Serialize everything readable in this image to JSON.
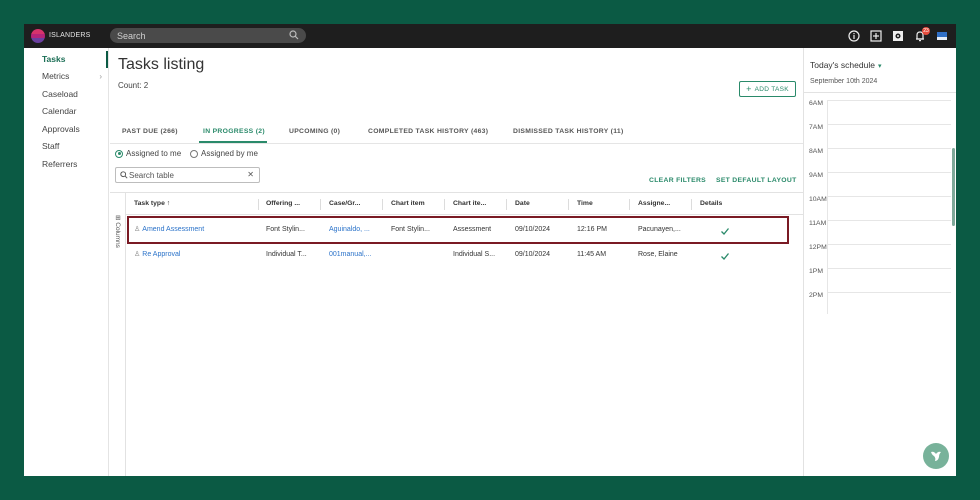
{
  "topbar": {
    "brand": "ISLANDERS",
    "search_placeholder": "Search",
    "notification_count": "23",
    "icons": [
      "info-icon",
      "plus-square-icon",
      "settings-icon",
      "bell-icon",
      "profile-icon"
    ]
  },
  "sidebar": {
    "items": [
      {
        "label": "Tasks",
        "active": true
      },
      {
        "label": "Metrics",
        "has_children": true
      },
      {
        "label": "Caseload"
      },
      {
        "label": "Calendar"
      },
      {
        "label": "Approvals"
      },
      {
        "label": "Staff"
      },
      {
        "label": "Referrers"
      }
    ]
  },
  "main": {
    "title": "Tasks listing",
    "count": "Count: 2",
    "add_task_label": "ADD TASK",
    "tabs": [
      {
        "label": "PAST DUE (266)"
      },
      {
        "label": "IN PROGRESS (2)",
        "active": true
      },
      {
        "label": "UPCOMING (0)"
      },
      {
        "label": "COMPLETED TASK HISTORY (463)"
      },
      {
        "label": "DISMISSED TASK HISTORY (11)"
      }
    ],
    "filters": {
      "assigned_to_me": "Assigned to me",
      "assigned_by_me": "Assigned by me",
      "selected": "assigned_to_me"
    },
    "search_table_placeholder": "Search table",
    "clear_filters": "CLEAR FILTERS",
    "set_default_layout": "SET DEFAULT LAYOUT",
    "columns_label": "Columns",
    "table": {
      "headers": [
        "Task type",
        "Offering ...",
        "Case/Gr...",
        "Chart item",
        "Chart ite...",
        "Date",
        "Time",
        "Assigne...",
        "Details"
      ],
      "sort_indicator": "↑",
      "rows": [
        [
          "Amend Assessment",
          "Font Stylin...",
          "Aguinaldo, ...",
          "Font Stylin...",
          "Assessment",
          "09/10/2024",
          "12:16 PM",
          "Pacunayen,..."
        ],
        [
          "Re Approval",
          "Individual T...",
          "001manual,...",
          "",
          "Individual S...",
          "09/10/2024",
          "11:45 AM",
          "Rose, Elaine"
        ]
      ]
    }
  },
  "schedule": {
    "title": "Today's schedule",
    "date": "September 10th 2024",
    "hours": [
      "6AM",
      "7AM",
      "8AM",
      "9AM",
      "10AM",
      "11AM",
      "12PM",
      "1PM",
      "2PM"
    ]
  },
  "colors": {
    "accent": "#2a8a6a",
    "frame": "#0b5a44",
    "topbar": "#1e1e1e",
    "link": "#2a72c9",
    "highlight": "#7a1a24"
  }
}
